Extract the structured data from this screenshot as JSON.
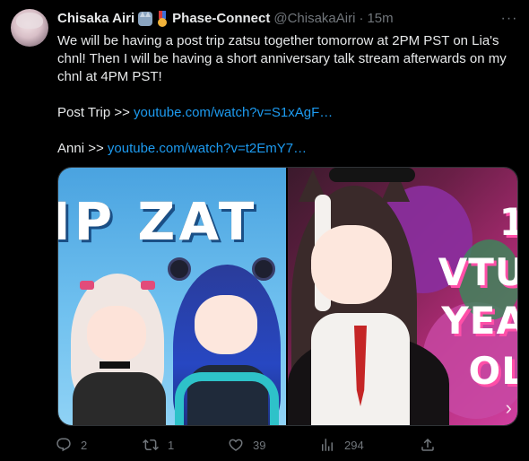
{
  "tweet": {
    "author_name": "Chisaka Airi",
    "group_name": "Phase-Connect",
    "handle": "@ChisakaAiri",
    "separator": "·",
    "time": "15m",
    "more_label": "···",
    "lines": [
      "We will be having a post trip zatsu together tomorrow at 2PM PST on Lia's chnl! Then I will be having a short anniversary talk stream afterwards on my chnl at 4PM PST!"
    ],
    "link1_prefix": "Post Trip >> ",
    "link1_text": "youtube.com/watch?v=S1xAgF…",
    "link2_prefix": "Anni >> ",
    "link2_text": "youtube.com/watch?v=t2EmY7…",
    "media": {
      "thumb1_title": "IP ZAT",
      "thumb2_text_1": "1",
      "thumb2_text_2": "VTU",
      "thumb2_text_3": "YEA",
      "thumb2_text_4": "OL",
      "next_arrow": "›"
    },
    "metrics": {
      "replies": "2",
      "reposts": "1",
      "likes": "39",
      "views": "294"
    }
  },
  "colors": {
    "background": "#000000",
    "text": "#e7e9ea",
    "secondary": "#71767b",
    "link": "#1d9bf0"
  }
}
